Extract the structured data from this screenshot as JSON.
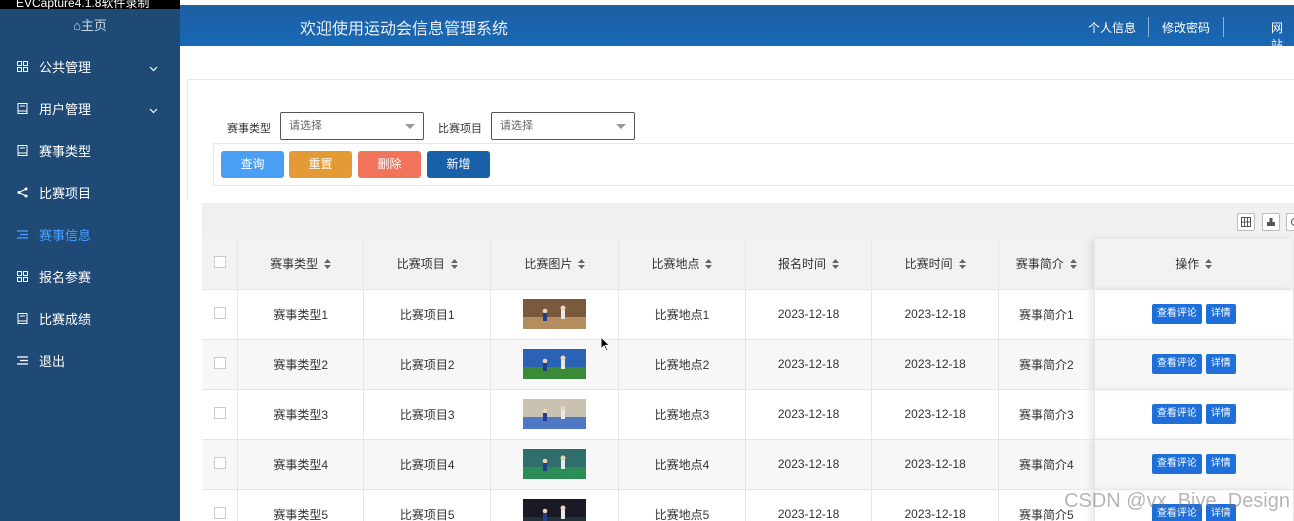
{
  "recorder": {
    "label": "EVCapture4.1.8软件录制"
  },
  "sidebar": {
    "home": "⌂主页",
    "items": [
      {
        "label": "公共管理",
        "icon": "grid-icon",
        "has_children": true
      },
      {
        "label": "用户管理",
        "icon": "book-icon",
        "has_children": true
      },
      {
        "label": "赛事类型",
        "icon": "book-icon",
        "has_children": false
      },
      {
        "label": "比赛项目",
        "icon": "share-icon",
        "has_children": false
      },
      {
        "label": "赛事信息",
        "icon": "list-icon",
        "has_children": false,
        "active": true
      },
      {
        "label": "报名参赛",
        "icon": "grid-icon",
        "has_children": false
      },
      {
        "label": "比赛成绩",
        "icon": "book-icon",
        "has_children": false
      },
      {
        "label": "退出",
        "icon": "list-icon",
        "has_children": false
      }
    ]
  },
  "header": {
    "title": "欢迎使用运动会信息管理系统",
    "links": [
      "个人信息",
      "修改密码",
      "网站"
    ]
  },
  "search": {
    "type_label": "赛事类型",
    "type_placeholder": "请选择",
    "project_label": "比赛项目",
    "project_placeholder": "请选择"
  },
  "actions": {
    "query": "查询",
    "reset": "重置",
    "delete": "删除",
    "add": "新增"
  },
  "colors": {
    "sidebar_bg": "#1f4a76",
    "header_bg": "#1868b4",
    "query": "#4a9ff5",
    "reset": "#e49a35",
    "delete": "#f0735a",
    "add": "#1861a8",
    "op_button": "#1e6fd9"
  },
  "table": {
    "columns": [
      "赛事类型",
      "比赛项目",
      "比赛图片",
      "比赛地点",
      "报名时间",
      "比赛时间",
      "赛事简介",
      "操作"
    ],
    "op_labels": {
      "comments": "查看评论",
      "detail": "详情"
    },
    "rows": [
      {
        "type": "赛事类型1",
        "project": "比赛项目1",
        "image": "badminton-photo",
        "place": "比赛地点1",
        "signup": "2023-12-18",
        "match": "2023-12-18",
        "intro": "赛事简介1"
      },
      {
        "type": "赛事类型2",
        "project": "比赛项目2",
        "image": "badminton-photo",
        "place": "比赛地点2",
        "signup": "2023-12-18",
        "match": "2023-12-18",
        "intro": "赛事简介2"
      },
      {
        "type": "赛事类型3",
        "project": "比赛项目3",
        "image": "badminton-photo",
        "place": "比赛地点3",
        "signup": "2023-12-18",
        "match": "2023-12-18",
        "intro": "赛事简介3"
      },
      {
        "type": "赛事类型4",
        "project": "比赛项目4",
        "image": "badminton-photo",
        "place": "比赛地点4",
        "signup": "2023-12-18",
        "match": "2023-12-18",
        "intro": "赛事简介4"
      },
      {
        "type": "赛事类型5",
        "project": "比赛项目5",
        "image": "badminton-photo",
        "place": "比赛地点5",
        "signup": "2023-12-18",
        "match": "2023-12-18",
        "intro": "赛事简介5"
      }
    ]
  },
  "watermark": "CSDN @vx_Biye_Design"
}
